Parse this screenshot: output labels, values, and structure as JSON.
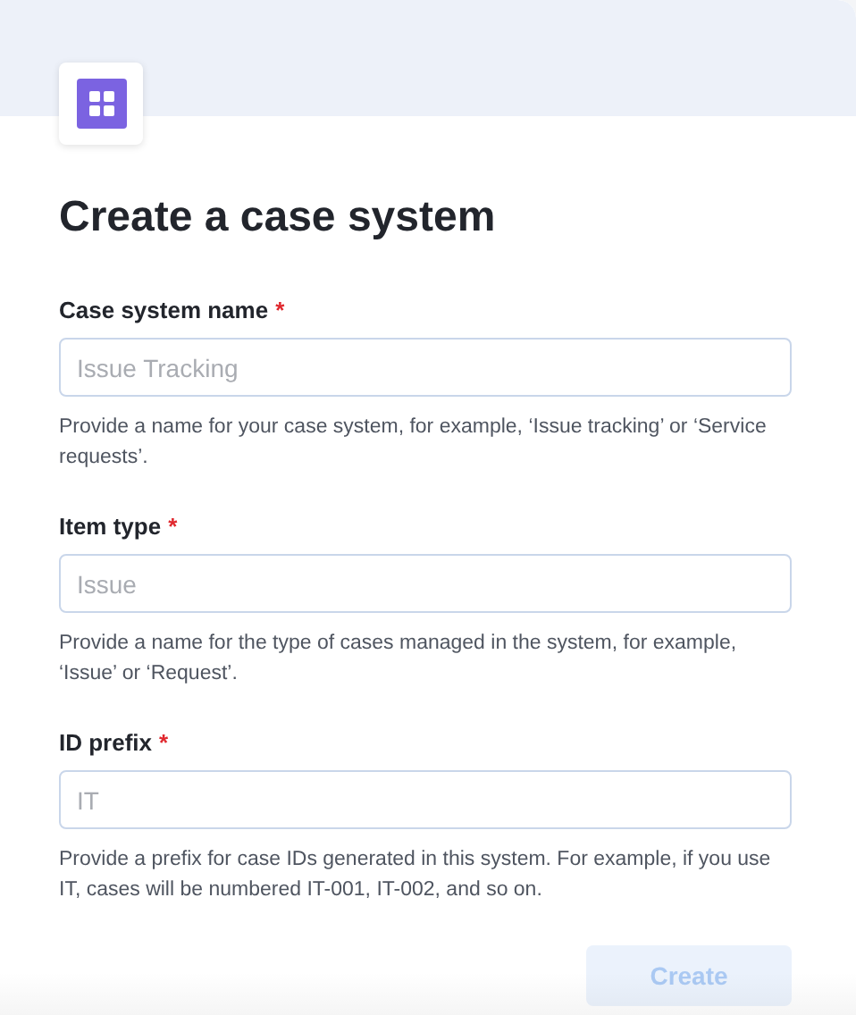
{
  "title": "Create a case system",
  "fields": [
    {
      "label": "Case system name",
      "required": true,
      "required_mark": "*",
      "placeholder": "Issue Tracking",
      "help": "Provide a name for your case system, for example, ‘Issue tracking’ or ‘Service requests’."
    },
    {
      "label": "Item type",
      "required": true,
      "required_mark": "*",
      "placeholder": "Issue",
      "help": "Provide a name for the type of cases managed in the system, for example, ‘Issue’ or ‘Request’."
    },
    {
      "label": "ID prefix",
      "required": true,
      "required_mark": "*",
      "placeholder": "IT",
      "help": "Provide a prefix for case IDs generated in this system. For example, if you use IT, cases will be numbered IT-001, IT-002, and so on."
    }
  ],
  "button": {
    "label": "Create",
    "disabled": true
  }
}
